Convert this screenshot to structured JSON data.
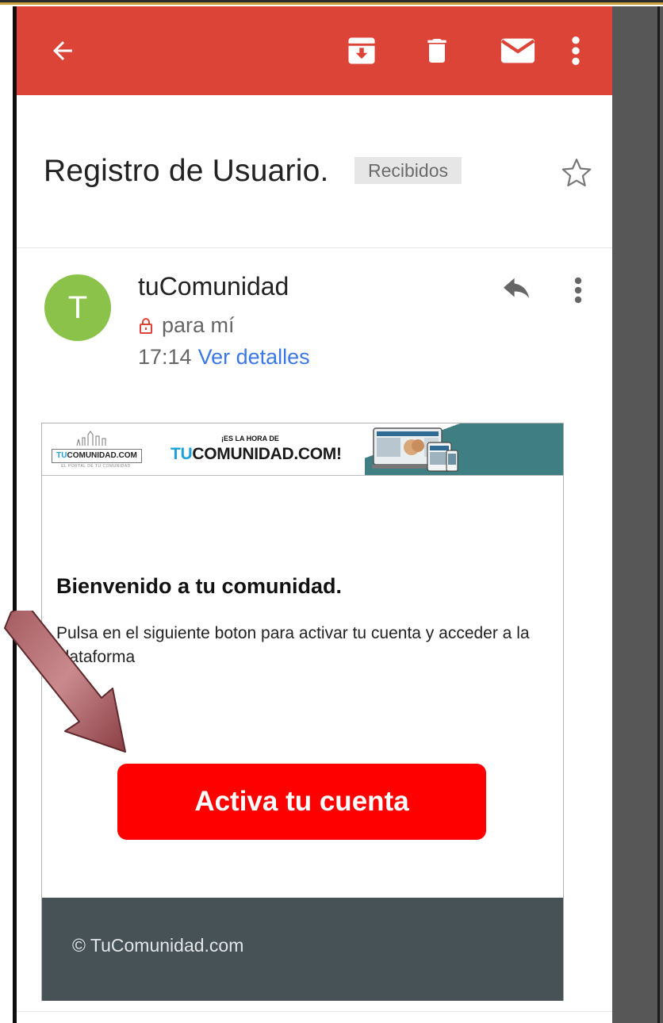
{
  "toolbar": {
    "back_icon": "arrow-back-icon",
    "archive_icon": "archive-icon",
    "delete_icon": "trash-icon",
    "mark_unread_icon": "mail-icon",
    "overflow_icon": "more-vert-icon",
    "color": "#db4437"
  },
  "message": {
    "subject": "Registro de Usuario.",
    "label": "Recibidos",
    "star_icon": "star-outline-icon"
  },
  "sender": {
    "avatar_letter": "T",
    "avatar_color": "#8bc34a",
    "name": "tuComunidad",
    "recipient": "para mí",
    "time": "17:14",
    "details_link": "Ver detalles",
    "reply_icon": "reply-icon",
    "more_icon": "more-vert-icon"
  },
  "email": {
    "banner": {
      "logo_text_tu": "TU",
      "logo_text_rest": "COMUNIDAD.COM",
      "logo_tagline": "EL PORTAL DE TU COMUNIDAD",
      "headline_small": "¡ES LA HORA DE",
      "headline_big_tu": "TU",
      "headline_big_rest": "COMUNIDAD.COM!"
    },
    "welcome_title": "Bienvenido a tu comunidad.",
    "welcome_body": "Pulsa en el siguiente boton para activar tu cuenta y acceder a la plataforma",
    "activate_button": "Activa tu cuenta",
    "button_color": "#ff0000",
    "footer": "© TuComunidad.com",
    "footer_color": "#475257"
  }
}
